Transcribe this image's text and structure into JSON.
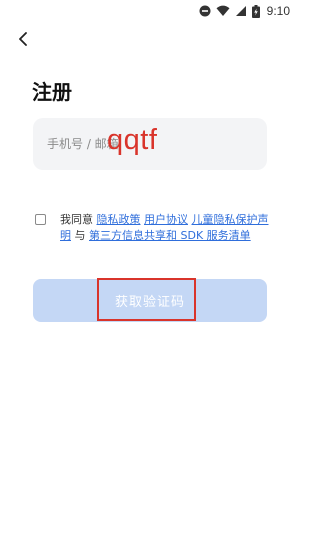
{
  "status_bar": {
    "time": "9:10",
    "icons": [
      "do-not-disturb-icon",
      "wifi-icon",
      "signal-icon",
      "battery-charging-icon"
    ]
  },
  "nav": {
    "back_icon": "chevron-left-icon"
  },
  "title": "注册",
  "account_input": {
    "placeholder": "手机号 / 邮箱",
    "value": ""
  },
  "overlay_annotation": "qqtf",
  "agreement": {
    "prefix": "我同意",
    "privacy_policy": "隐私政策",
    "user_agreement": "用户协议",
    "child_privacy": "儿童隐私保护声明",
    "conjunction": "与",
    "third_party_sdk": "第三方信息共享和 SDK 服务清单"
  },
  "submit_button": {
    "label": "获取验证码"
  },
  "colors": {
    "accent": "#2f6edb",
    "button_disabled": "#c4d7f5",
    "input_bg": "#f3f4f6",
    "annotation": "#d9342b"
  }
}
